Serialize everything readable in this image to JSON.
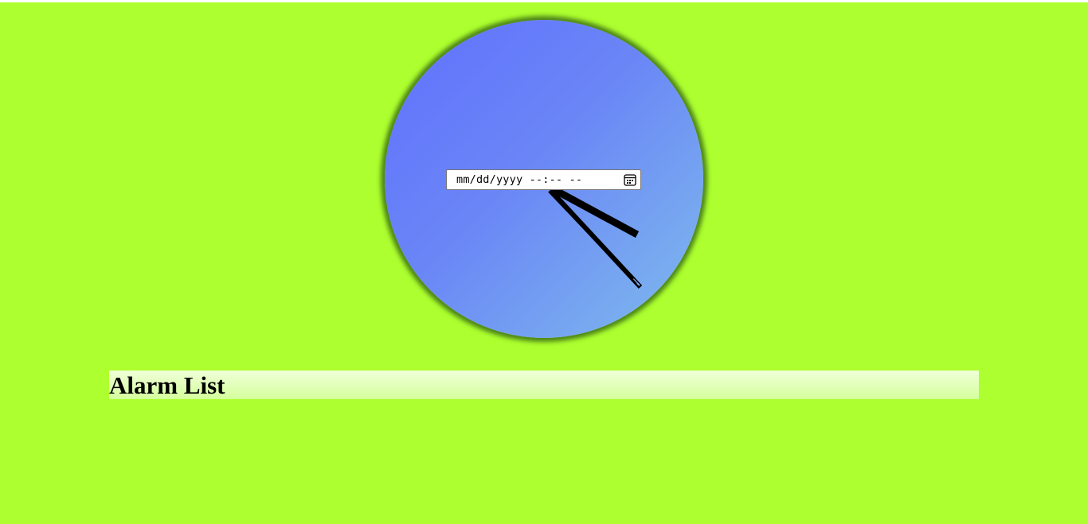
{
  "clock": {
    "hand_times": {
      "hour": "4:20",
      "minute": "22",
      "second": "22"
    },
    "face_gradient": [
      "#6170ff",
      "#7fbcec"
    ],
    "hand_color": "#000000"
  },
  "alarm_input": {
    "placeholder": "mm/dd/yyyy --:-- --",
    "calendar_icon": "calendar-icon"
  },
  "alarm_section": {
    "title": "Alarm List",
    "items": []
  },
  "colors": {
    "background": "#adff2f",
    "header_bar": "#e0ffb8"
  }
}
